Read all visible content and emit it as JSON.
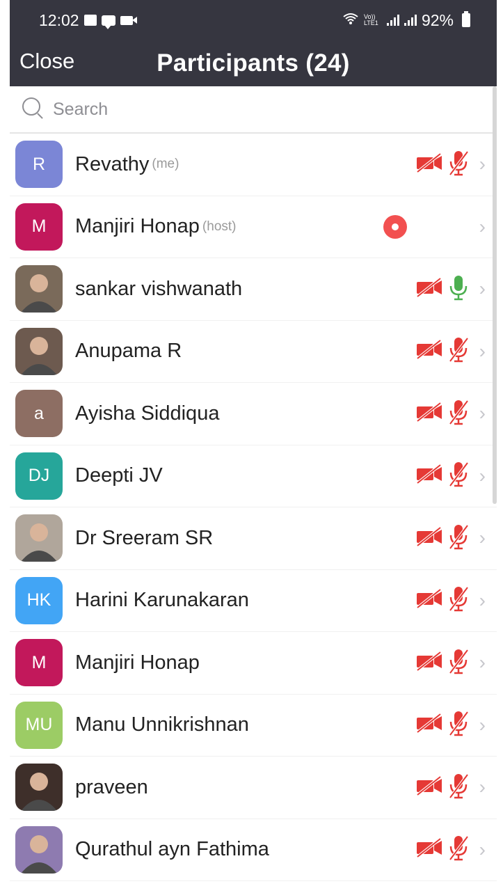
{
  "status_bar": {
    "time": "12:02",
    "network": "Vo)) LTE1",
    "battery": "92%"
  },
  "header": {
    "close_label": "Close",
    "title": "Participants (24)"
  },
  "search": {
    "placeholder": "Search"
  },
  "colors": {
    "header_bg": "#363640",
    "muted_red": "#e53935",
    "mic_on_green": "#4caf50",
    "record_red": "#f25050"
  },
  "participants": [
    {
      "name": "Revathy",
      "tag": "(me)",
      "initials": "R",
      "avatar_color": "#7b86d6",
      "video": "off",
      "audio": "muted"
    },
    {
      "name": "Manjiri Honap",
      "tag": "(host)",
      "initials": "M",
      "avatar_color": "#c2185b",
      "video": "none",
      "audio": "none",
      "recording": true
    },
    {
      "name": "sankar vishwanath",
      "tag": "",
      "initials": "",
      "avatar_color": "#7a6a5a",
      "video": "off",
      "audio": "on"
    },
    {
      "name": "Anupama R",
      "tag": "",
      "initials": "",
      "avatar_color": "#6d5a4f",
      "video": "off",
      "audio": "muted"
    },
    {
      "name": "Ayisha Siddiqua",
      "tag": "",
      "initials": "a",
      "avatar_color": "#8d6e63",
      "video": "off",
      "audio": "muted"
    },
    {
      "name": "Deepti JV",
      "tag": "",
      "initials": "DJ",
      "avatar_color": "#26a69a",
      "video": "off",
      "audio": "muted"
    },
    {
      "name": "Dr Sreeram SR",
      "tag": "",
      "initials": "",
      "avatar_color": "#b0a69b",
      "video": "off",
      "audio": "muted"
    },
    {
      "name": "Harini Karunakaran",
      "tag": "",
      "initials": "HK",
      "avatar_color": "#42a5f5",
      "video": "off",
      "audio": "muted"
    },
    {
      "name": "Manjiri Honap",
      "tag": "",
      "initials": "M",
      "avatar_color": "#c2185b",
      "video": "off",
      "audio": "muted"
    },
    {
      "name": "Manu Unnikrishnan",
      "tag": "",
      "initials": "MU",
      "avatar_color": "#9ccc65",
      "video": "off",
      "audio": "muted"
    },
    {
      "name": "praveen",
      "tag": "",
      "initials": "",
      "avatar_color": "#3e2f2a",
      "video": "off",
      "audio": "muted"
    },
    {
      "name": "Qurathul ayn Fathima",
      "tag": "",
      "initials": "",
      "avatar_color": "#8e7bb0",
      "video": "off",
      "audio": "muted"
    }
  ]
}
